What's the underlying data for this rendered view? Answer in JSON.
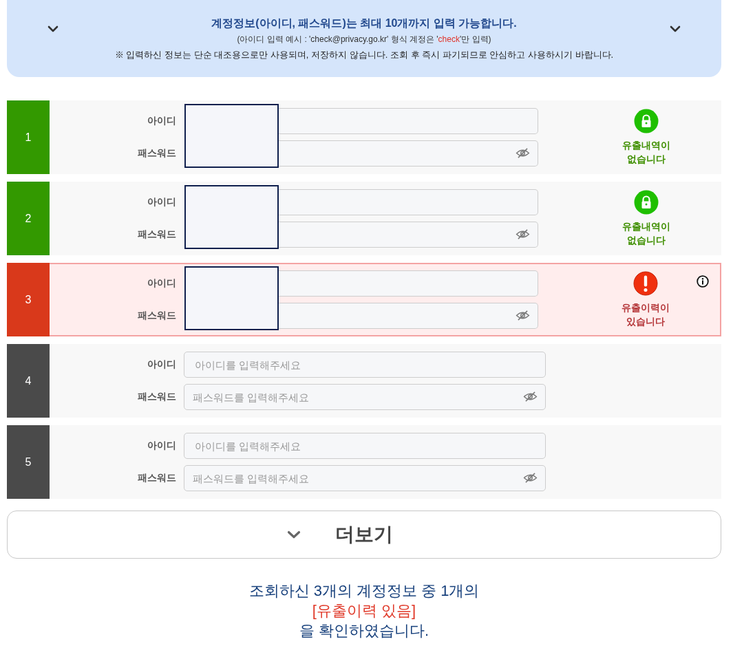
{
  "notice": {
    "title": "계정정보(아이디, 패스워드)는 최대 10개까지 입력 가능합니다.",
    "example_note": [
      {
        "text": "(아이디 입력 예시 : 'check@privacy.go.kr' 형식 계정은 '",
        "highlight": false
      },
      {
        "text": "check",
        "highlight": true
      },
      {
        "text": "'만 입력)",
        "highlight": false
      }
    ],
    "privacy_note": "※ 입력하신 정보는 단순 대조용으로만 사용되며, 저장하지 않습니다. 조회 후 즉시 파기되므로 안심하고 사용하시기 바랍니다."
  },
  "accounts": [
    {
      "number": "1",
      "kind": "safe",
      "status_text": "유출내역이 없습니다",
      "redacted": true,
      "fields": [
        {
          "kind": "id",
          "label": "아이디"
        },
        {
          "kind": "password",
          "label": "패스워드"
        }
      ]
    },
    {
      "number": "2",
      "kind": "safe",
      "status_text": "유출내역이 없습니다",
      "redacted": true,
      "fields": [
        {
          "kind": "id",
          "label": "아이디"
        },
        {
          "kind": "password",
          "label": "패스워드"
        }
      ]
    },
    {
      "number": "3",
      "kind": "leaked",
      "status_text": "유출이력이 있습니다",
      "redacted": true,
      "fields": [
        {
          "kind": "id",
          "label": "아이디"
        },
        {
          "kind": "password",
          "label": "패스워드"
        }
      ]
    },
    {
      "number": "4",
      "kind": "unchecked",
      "redacted": false,
      "fields": [
        {
          "kind": "id",
          "label": "아이디",
          "placeholder": "아이디를 입력해주세요"
        },
        {
          "kind": "password",
          "label": "패스워드",
          "placeholder": "패스워드를 입력해주세요"
        }
      ]
    },
    {
      "number": "5",
      "kind": "unchecked",
      "redacted": false,
      "fields": [
        {
          "kind": "id",
          "label": "아이디",
          "placeholder": "아이디를 입력해주세요"
        },
        {
          "kind": "password",
          "label": "패스워드",
          "placeholder": "패스워드를 입력해주세요"
        }
      ]
    }
  ],
  "more_button": {
    "label": "더보기"
  },
  "summary": [
    {
      "text": "조회하신 3개의 계정정보 중 1개의",
      "highlight": false
    },
    {
      "text": "[유출이력 있음]",
      "highlight": true
    },
    {
      "text": "을 확인하였습니다.",
      "highlight": false
    }
  ]
}
